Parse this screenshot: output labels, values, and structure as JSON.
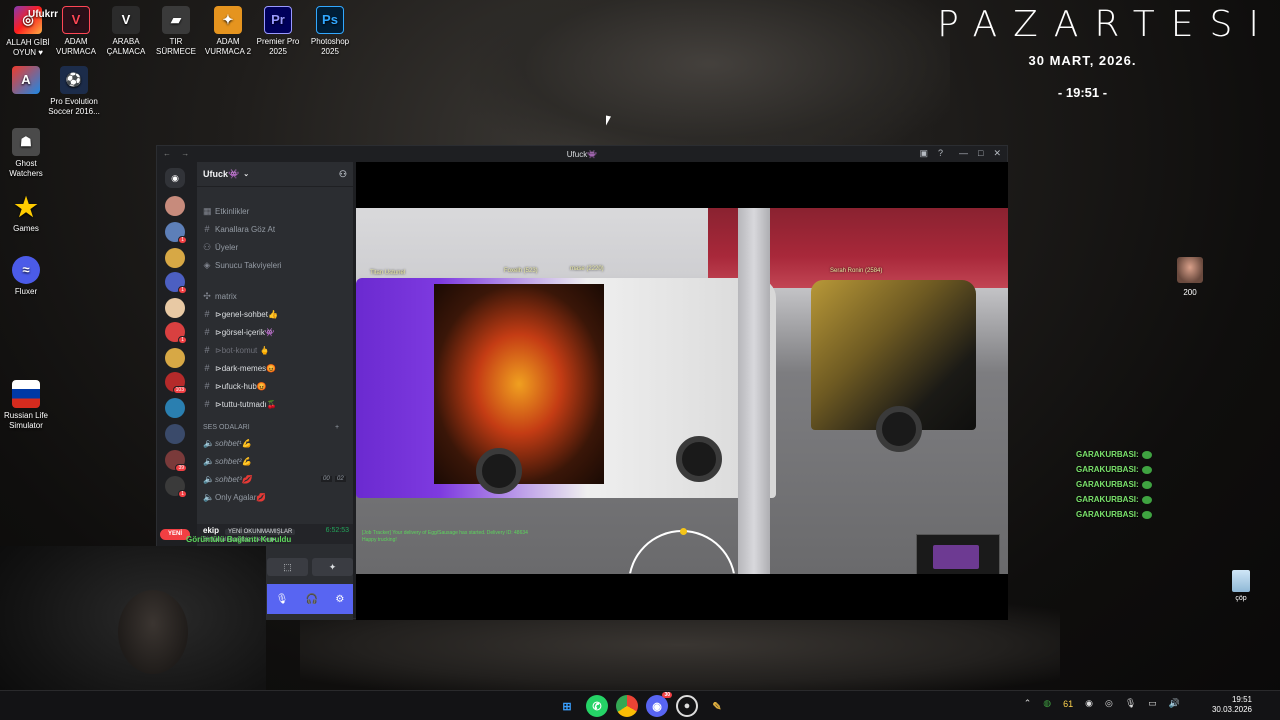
{
  "desktop": {
    "icons": [
      {
        "label": "Ufukrr"
      },
      {
        "label": "ALLAH GİBİ OYUN ♥"
      },
      {
        "label": "ADAM VURMACA"
      },
      {
        "label": "ARABA ÇALMACA"
      },
      {
        "label": "TIR SÜRMECE"
      },
      {
        "label": "ADAM VURMACA 2"
      },
      {
        "label": "Premier Pro 2025"
      },
      {
        "label": "Photoshop 2025"
      },
      {
        "label": "Pro Evolution Soccer 2016..."
      },
      {
        "label": "Ghost Watchers"
      },
      {
        "label": "Games"
      },
      {
        "label": "Fluxer"
      },
      {
        "label": "Russian Life Simulator"
      }
    ],
    "icon_glyphs": {
      "premiere": "Pr",
      "photoshop": "Ps"
    },
    "avatar_count": "200",
    "trash_label": "çöp",
    "garakurbasi": [
      "GARAKURBASI:",
      "GARAKURBASI:",
      "GARAKURBASI:",
      "GARAKURBASI:",
      "GARAKURBASI:"
    ],
    "connection_text": "Görüntülü Bağlantı Kuruldu"
  },
  "clock_widget": {
    "day": "PAZARTESI",
    "date": "30 MART, 2026.",
    "time": "- 19:51 -"
  },
  "discord": {
    "window_title": "Ufuck👾",
    "server_name": "Ufuck👾",
    "menu": [
      "Etkinlikler",
      "Kanallara Göz At",
      "Üyeler",
      "Sunucu Takviyeleri"
    ],
    "category": "matrix",
    "text_channels": [
      {
        "name": "⊳genel-sohbet👍"
      },
      {
        "name": "⊳görsel-içerik👾"
      },
      {
        "name": "⊳bot-komut 🖕"
      },
      {
        "name": "⊳dark-memes😡"
      },
      {
        "name": "⊳ufuck-hub😡"
      },
      {
        "name": "⊳tuttu-tutmadı🍒"
      }
    ],
    "voice_category": "SES ODALARI",
    "voice_channels": [
      {
        "name": "sohbet¹💪"
      },
      {
        "name": "sohbet²💪"
      },
      {
        "name": "sohbet³💋"
      },
      {
        "name": "Only Agalar💋"
      }
    ],
    "voice_counts": [
      "00",
      "02"
    ],
    "yeni_badge": "YENİ",
    "server_badges": [
      "1",
      "1",
      "1",
      "103",
      "39",
      "1"
    ],
    "active_voice": {
      "name": "ekip",
      "status": "YENİ OKUNMAMIŞLAR",
      "timer": "6:52:53",
      "sub": "Bir kanalı ücretsiz izleme ▶"
    },
    "game": {
      "players": [
        "Titan Ustunel",
        "Foxelh (523)",
        "mase (2220)",
        "Serah Ronin (2584)"
      ],
      "chat": [
        "[Job Tracker] Your delivery of Egg/Sausage has started. Delivery ID: 48634",
        "Happy trucking!"
      ]
    }
  },
  "taskbar": {
    "tray_numbers": [
      "61"
    ],
    "time": "19:51",
    "date": "30.03.2026",
    "badge": "30"
  },
  "colors": {
    "discord_bg": "#1e1f22",
    "discord_panel": "#2b2d31",
    "blurple": "#5865f2",
    "green": "#7be36c",
    "red": "#f23f43"
  }
}
